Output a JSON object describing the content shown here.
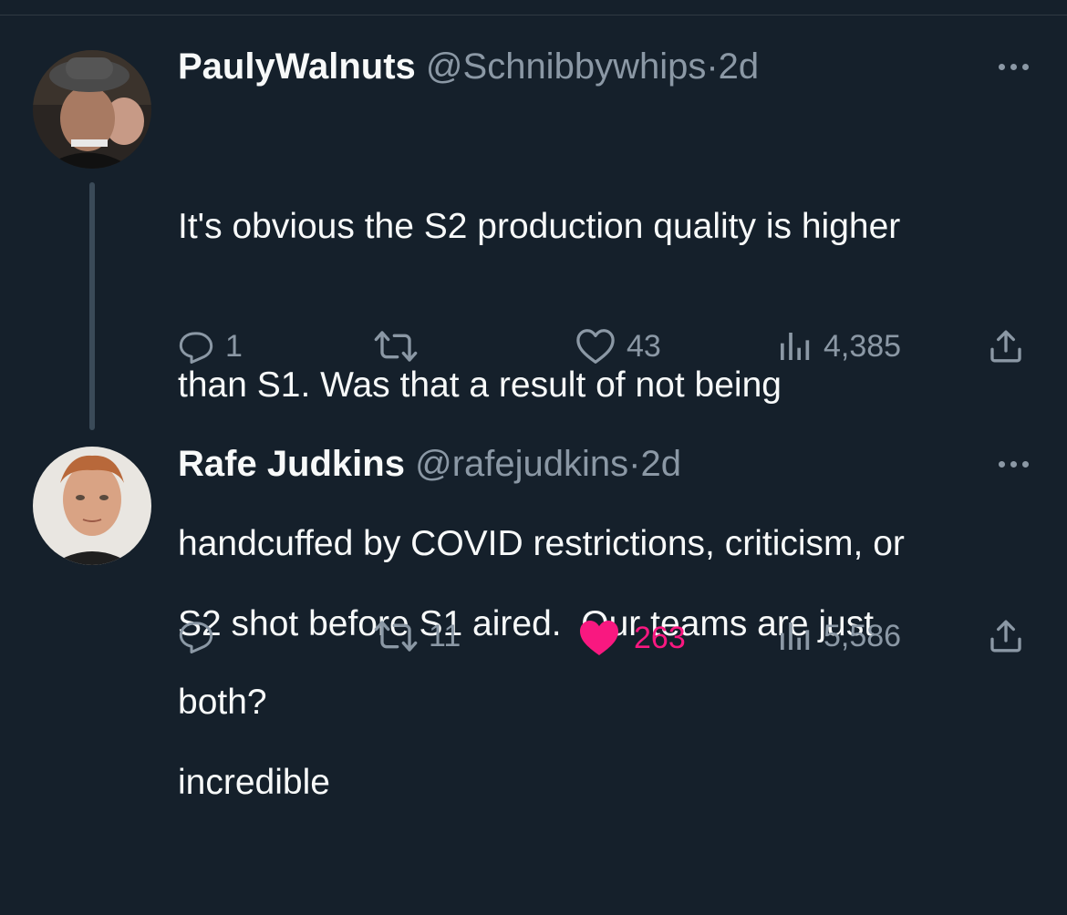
{
  "tweets": [
    {
      "name": "PaulyWalnuts",
      "handle": "@Schnibbywhips",
      "separator": "·",
      "time": "2d",
      "text": "It's obvious the S2 production quality is higher than S1. Was that a result of not being handcuffed by COVID restrictions, criticism, or both?",
      "text_lines": [
        "It's obvious the S2 production quality is higher",
        "than S1. Was that a result of not being",
        "handcuffed by COVID restrictions, criticism, or",
        "both?"
      ],
      "replies": "1",
      "retweets": "",
      "likes": "43",
      "views": "4,385",
      "liked": false
    },
    {
      "name": "Rafe Judkins",
      "handle": "@rafejudkins",
      "separator": "·",
      "time": "2d",
      "text_lines": [
        "S2 shot before S1 aired.  Our teams are just",
        "incredible"
      ],
      "replies": "",
      "retweets": "11",
      "likes": "263",
      "views": "5,586",
      "liked": true
    }
  ],
  "icons": {
    "reply": "reply-icon",
    "retweet": "retweet-icon",
    "like": "heart-icon",
    "views": "views-icon",
    "share": "share-icon",
    "more": "more-icon"
  },
  "colors": {
    "background": "#15202b",
    "text": "#f7f9f9",
    "muted": "#8b98a5",
    "like": "#f91880"
  }
}
